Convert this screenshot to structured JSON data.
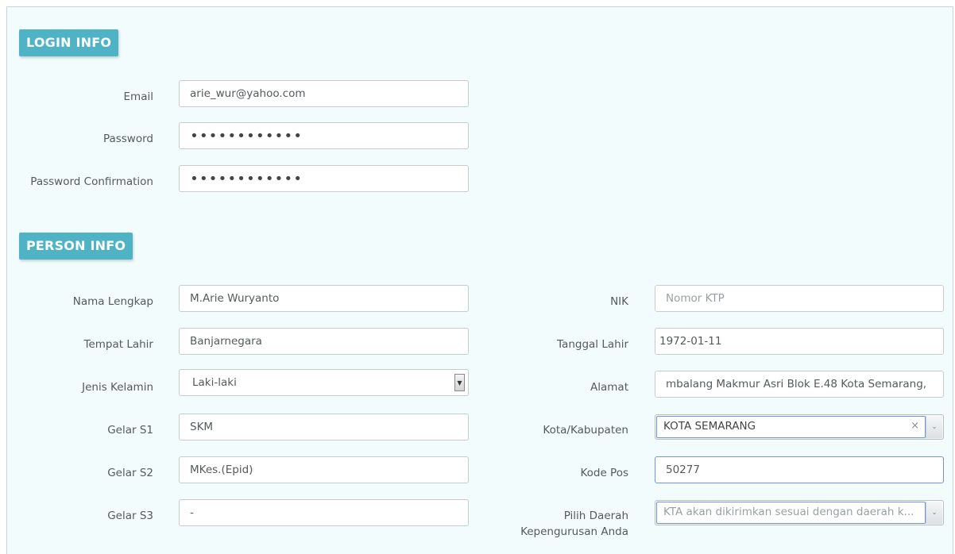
{
  "login_info": {
    "heading": "LOGIN INFO",
    "email_label": "Email",
    "email_value": "arie_wur@yahoo.com",
    "password_label": "Password",
    "password_value": "••••••••••••",
    "password_confirm_label": "Password Confirmation",
    "password_confirm_value": "••••••••••••"
  },
  "person_info": {
    "heading": "PERSON INFO",
    "nama_label": "Nama Lengkap",
    "nama_value": "M.Arie Wuryanto",
    "tempat_label": "Tempat Lahir",
    "tempat_value": "Banjarnegara",
    "jenis_label": "Jenis Kelamin",
    "jenis_value": "Laki-laki",
    "s1_label": "Gelar S1",
    "s1_value": "SKM",
    "s2_label": "Gelar S2",
    "s2_value": "MKes.(Epid)",
    "s3_label": "Gelar S3",
    "s3_value": "-",
    "nik_label": "NIK",
    "nik_placeholder": "Nomor KTP",
    "tgl_label": "Tanggal Lahir",
    "tgl_value": "1972-01-11",
    "alamat_label": "Alamat",
    "alamat_value": "mbalang Makmur Asri Blok E.48 Kota Semarang,",
    "kota_label": "Kota/Kabupaten",
    "kota_value": "KOTA SEMARANG",
    "kota_clear": "×",
    "kodepos_label": "Kode Pos",
    "kodepos_value": "50277",
    "daerah_label_line1": "Pilih Daerah",
    "daerah_label_line2": "Kepengurusan Anda",
    "daerah_placeholder": "KTA akan dikirimkan sesuai dengan daerah k..."
  },
  "icons": {
    "dropdown_arrow": "▼",
    "select_arrow": "⌄"
  }
}
